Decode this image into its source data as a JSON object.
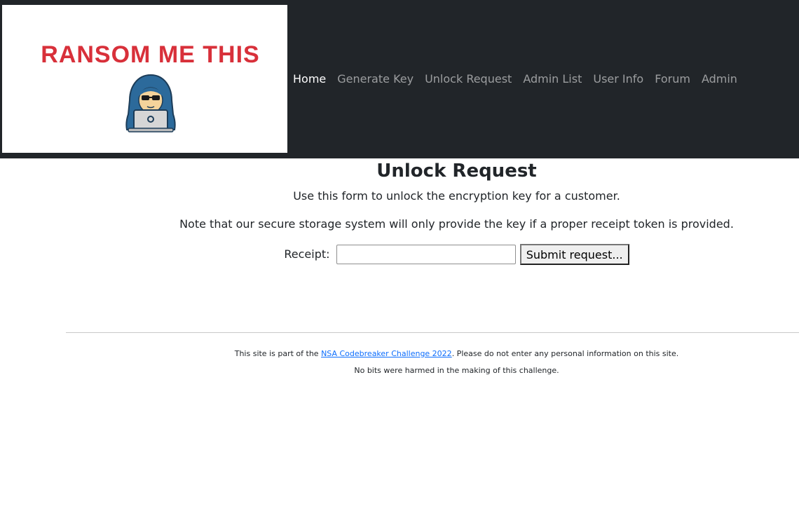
{
  "brand": {
    "logo_text": "RANSOM ME THIS",
    "logo_color": "#d8303a"
  },
  "nav": {
    "items": [
      {
        "label": "Home",
        "active": true
      },
      {
        "label": "Generate Key",
        "active": false
      },
      {
        "label": "Unlock Request",
        "active": false
      },
      {
        "label": "Admin List",
        "active": false
      },
      {
        "label": "User Info",
        "active": false
      },
      {
        "label": "Forum",
        "active": false
      },
      {
        "label": "Admin",
        "active": false
      }
    ]
  },
  "main": {
    "title": "Unlock Request",
    "description": "Use this form to unlock the encryption key for a customer.",
    "note": "Note that our secure storage system will only provide the key if a proper receipt token is provided.",
    "form": {
      "receipt_label": "Receipt:",
      "receipt_value": "",
      "submit_label": "Submit request..."
    }
  },
  "footer": {
    "text_before": "This site is part of the ",
    "link_text": "NSA Codebreaker Challenge 2022",
    "text_after": ". Please do not enter any personal information on this site.",
    "line2": "No bits were harmed in the making of this challenge."
  },
  "colors": {
    "navbar_bg": "#212529",
    "link_blue": "#0d6efd"
  }
}
